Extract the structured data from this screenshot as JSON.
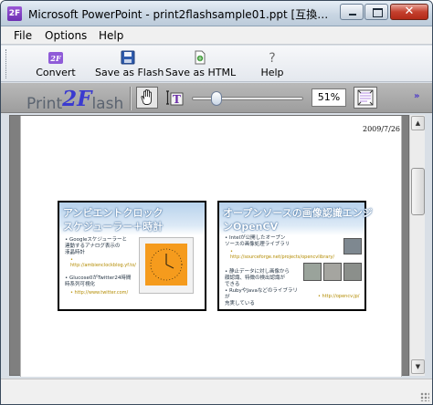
{
  "window": {
    "title": "Microsoft PowerPoint - print2flashsample01.ppt [互換モ…",
    "icon_glyph": "2F",
    "close_glyph": "✕"
  },
  "menu": {
    "items": [
      {
        "label": "File"
      },
      {
        "label": "Options"
      },
      {
        "label": "Help"
      }
    ]
  },
  "toolbar": {
    "buttons": [
      {
        "label": "Convert",
        "icon": "convert-icon"
      },
      {
        "label": "Save as Flash",
        "icon": "floppy-icon"
      },
      {
        "label": "Save as HTML",
        "icon": "html-page-icon"
      },
      {
        "label": "Help",
        "icon": "question-icon"
      }
    ]
  },
  "viewer": {
    "logo": {
      "part1": "Print",
      "part2": "2F",
      "part3": "lash"
    },
    "zoom": "51%",
    "zoom_fraction": 0.51,
    "more_glyph": "»",
    "page_date": "2009/7/26",
    "colors": {
      "logo_accent": "#3a3ad0",
      "toolbar_gray": "#ababab"
    }
  },
  "slides": [
    {
      "title_line1": "アンビエントクロック",
      "title_line2": "スケジューラー＋時計",
      "bullets": [
        {
          "text": "• Googleスケジューラーと\n  連動するアナログ表示の\n  液晶時計",
          "link": "• http://ambienclockblog.yf.to/"
        },
        {
          "text": "• Glucose0がTwitter24時間\n  時系列可視化",
          "link": "• http://www.twitter.com/"
        }
      ]
    },
    {
      "title_line1": "オープンソースの画像認識エンジ",
      "title_line2": "ンOpenCV",
      "bullets": [
        {
          "text": "• Intelが公開したオープン\n  ソースの画像処理ライブラリ",
          "link": "• http://sourceforge.net/projects/opencvlibrary/"
        },
        {
          "text": "• 静止データに対し画像から\n  顔認識、特徴の検出認識が\n  できる",
          "link": ""
        },
        {
          "text": "• RubyやJavaなどのライブラリが\n  充実している",
          "link": "• http://opencv.jp/"
        }
      ]
    }
  ],
  "scrollbar": {
    "up_glyph": "▲",
    "down_glyph": "▼"
  }
}
